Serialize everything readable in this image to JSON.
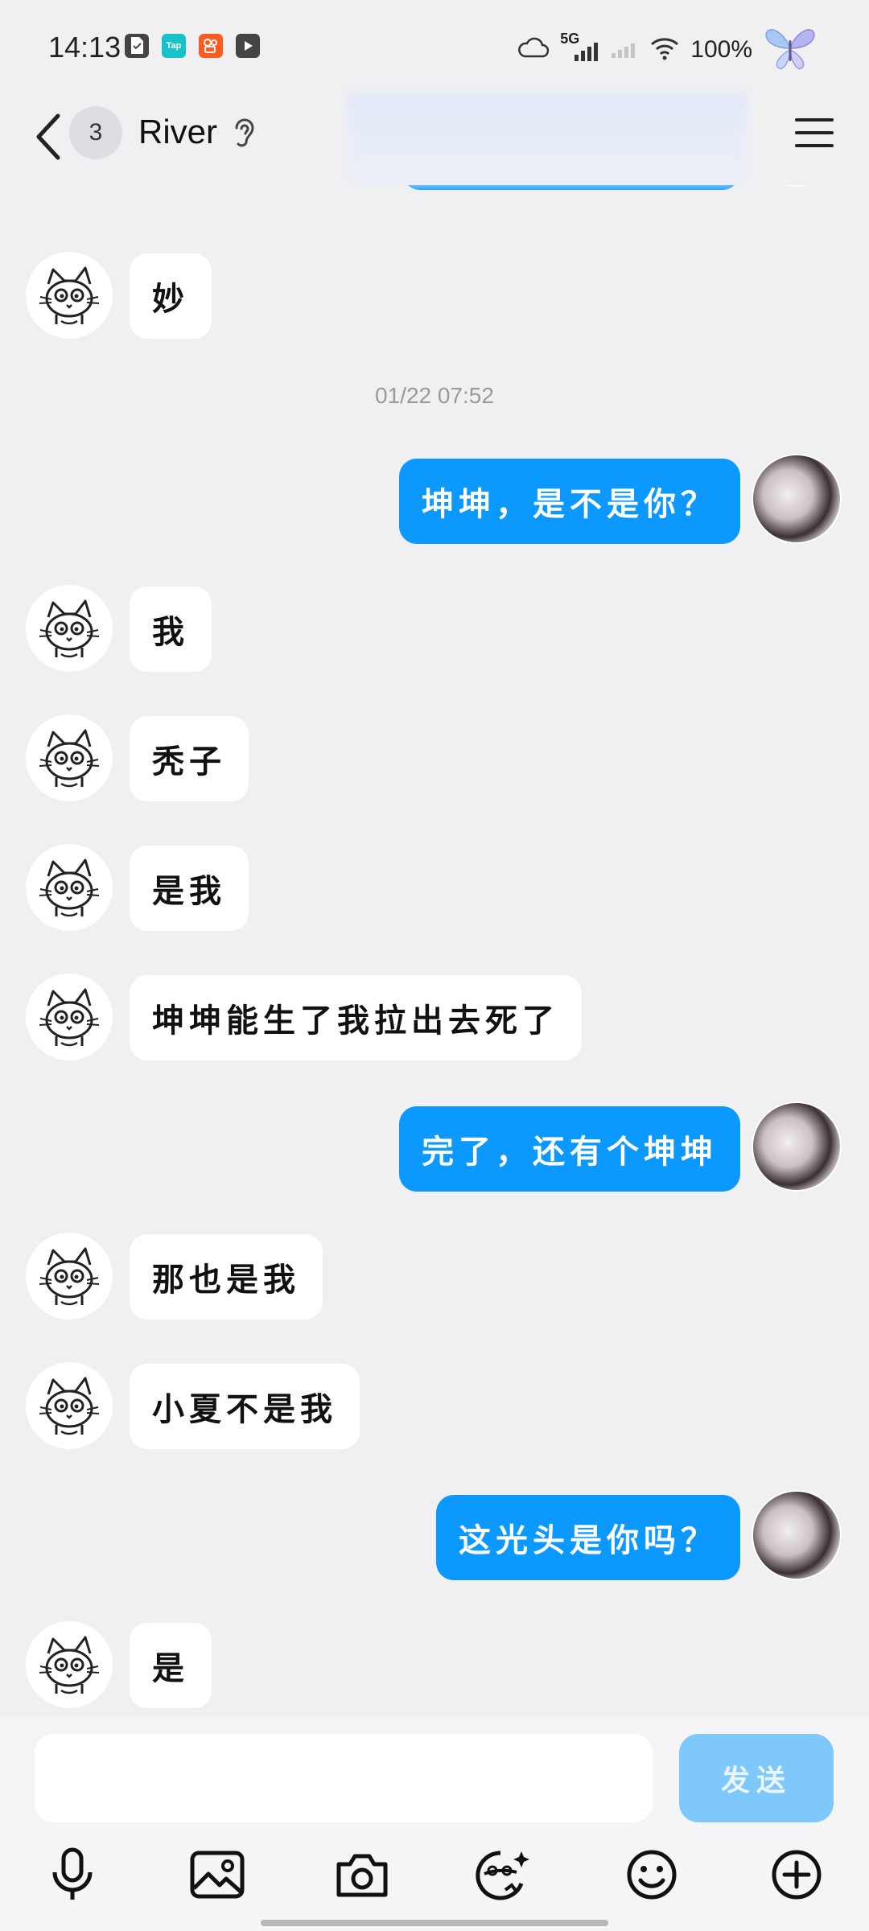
{
  "status_bar": {
    "time": "14:13",
    "network": "5G",
    "battery": "100%",
    "app_icons": [
      {
        "name": "sim-card-icon",
        "label": "",
        "color": "#444444"
      },
      {
        "name": "taptap-icon",
        "label": "Tap",
        "color": "#17c3c8"
      },
      {
        "name": "kuaishou-icon",
        "label": "",
        "color": "#ff5a1f"
      },
      {
        "name": "video-player-icon",
        "label": "",
        "color": "#444444"
      }
    ]
  },
  "header": {
    "unread_count": "3",
    "contact_name": "River"
  },
  "messages": [
    {
      "side": "in",
      "text": "妙"
    },
    {
      "side": "time",
      "text": "01/22 07:52"
    },
    {
      "side": "out",
      "text": "坤坤，是不是你？"
    },
    {
      "side": "in",
      "text": "我"
    },
    {
      "side": "in",
      "text": "秃子"
    },
    {
      "side": "in",
      "text": "是我"
    },
    {
      "side": "in",
      "text": "坤坤能生了我拉出去死了"
    },
    {
      "side": "out",
      "text": "完了，还有个坤坤"
    },
    {
      "side": "in",
      "text": "那也是我"
    },
    {
      "side": "in",
      "text": "小夏不是我"
    },
    {
      "side": "out",
      "text": "这光头是你吗？"
    },
    {
      "side": "in",
      "text": "是"
    }
  ],
  "input": {
    "placeholder": "",
    "value": "",
    "send_label": "发送"
  },
  "toolbar": [
    "microphone-icon",
    "image-icon",
    "camera-icon",
    "sticker-icon",
    "emoji-icon",
    "plus-icon"
  ],
  "colors": {
    "background": "#f0f0f2",
    "outgoing_bubble": "#0b99ff",
    "incoming_bubble": "#ffffff",
    "send_button": "#7ec8fb"
  }
}
